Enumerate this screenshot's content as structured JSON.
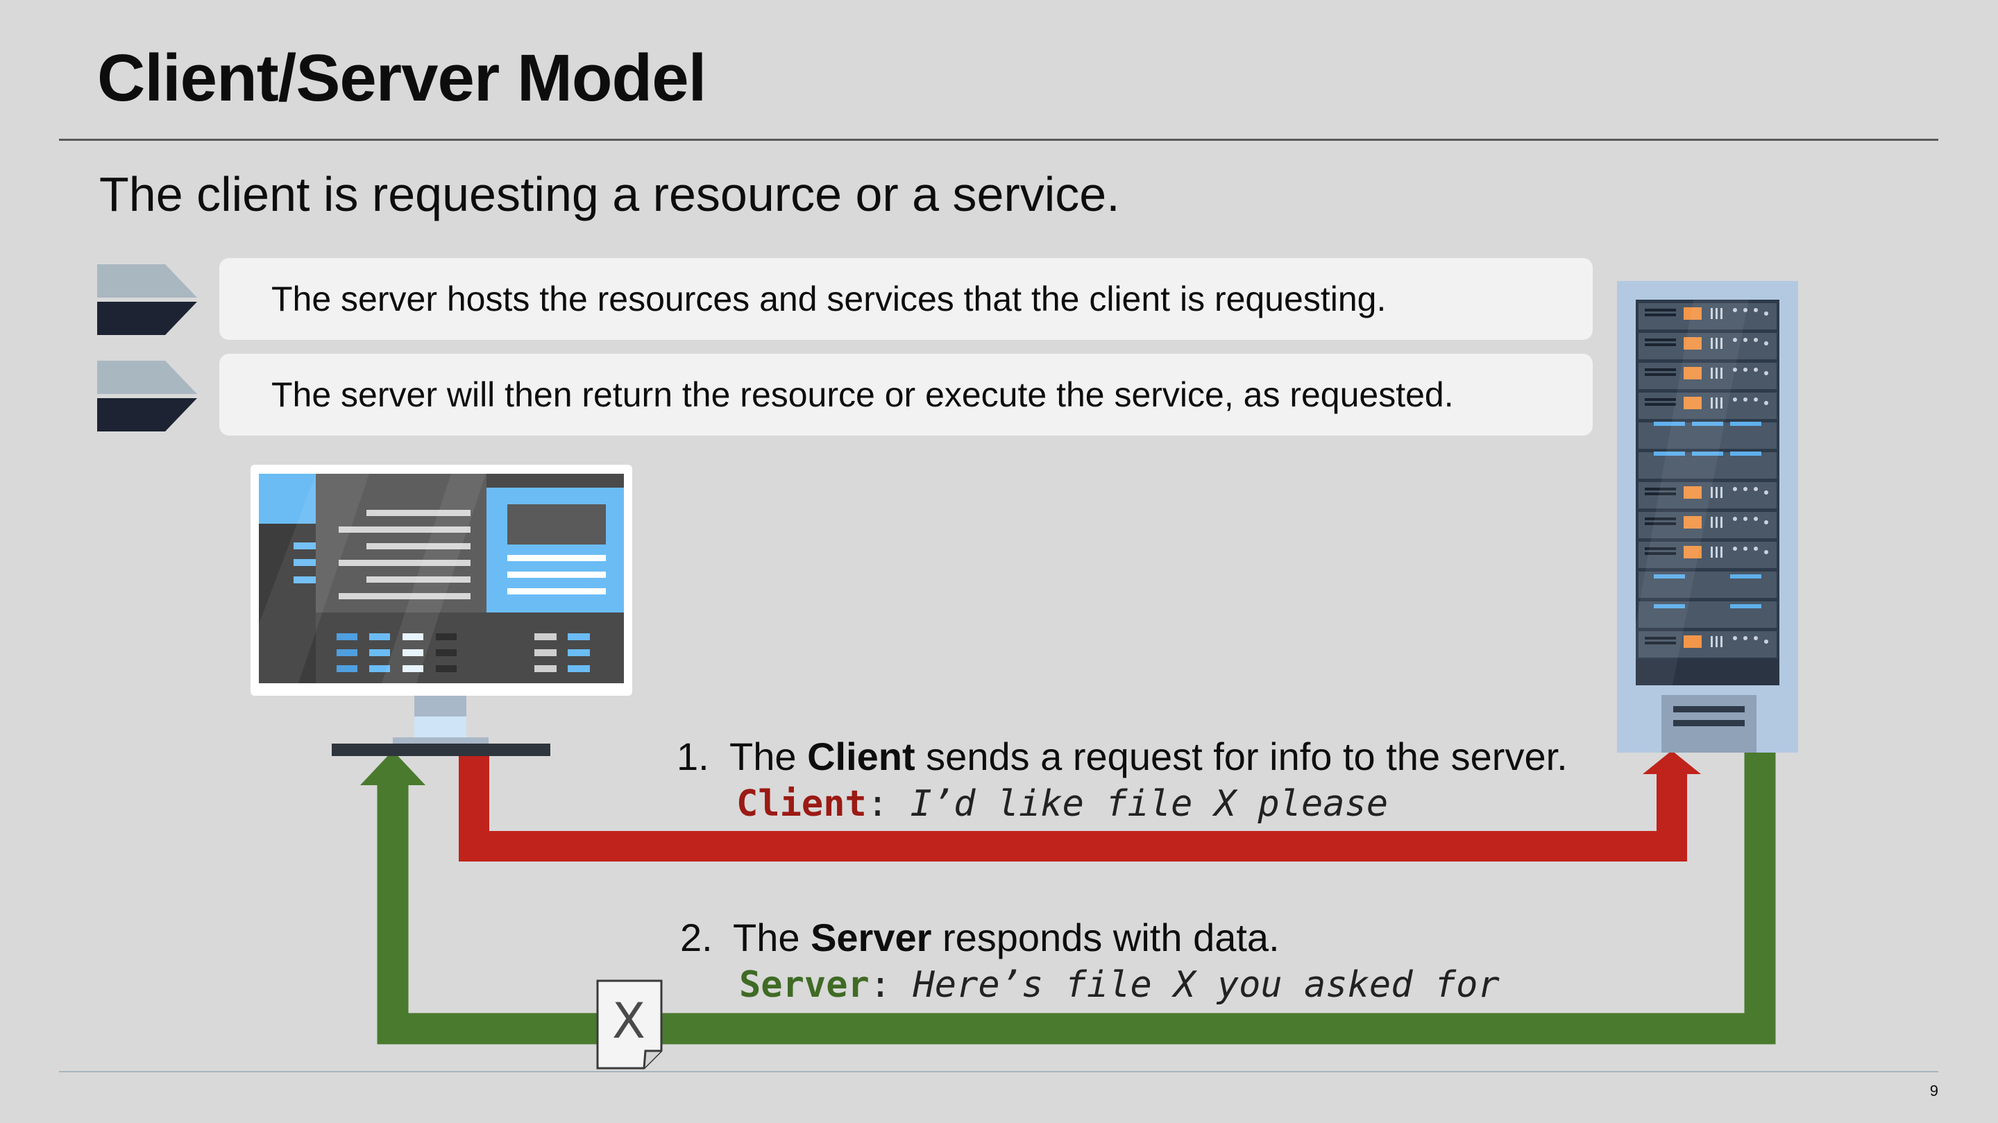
{
  "slide": {
    "title": "Client/Server Model",
    "subtitle": "The client is requesting a resource or a service.",
    "page_number": "9"
  },
  "bullets": [
    {
      "text": "The server hosts the resources and services that the client is requesting."
    },
    {
      "text": "The server will then return the resource or execute the service, as requested."
    }
  ],
  "steps": [
    {
      "number": "1.",
      "pre": "The ",
      "bold": "Client",
      "post": " sends a request for info to the server.",
      "speaker": "Client",
      "separator": ": ",
      "message": "I’d like file X please"
    },
    {
      "number": "2.",
      "pre": "The ",
      "bold": "Server",
      "post": " responds with data.",
      "speaker": "Server",
      "separator": ": ",
      "message": "Here’s file X you asked for"
    }
  ],
  "document_icon_label": "X",
  "icons": {
    "client": "desktop-monitor-icon",
    "server": "server-rack-icon",
    "document": "document-icon"
  },
  "colors": {
    "request_arrow": "#c0231b",
    "response_arrow": "#4a7a2e",
    "client_label": "#9b1a14",
    "server_label": "#3f6b25",
    "chevron_light": "#a9b7c1",
    "chevron_dark": "#1d2333",
    "background": "#d9d9d9"
  }
}
